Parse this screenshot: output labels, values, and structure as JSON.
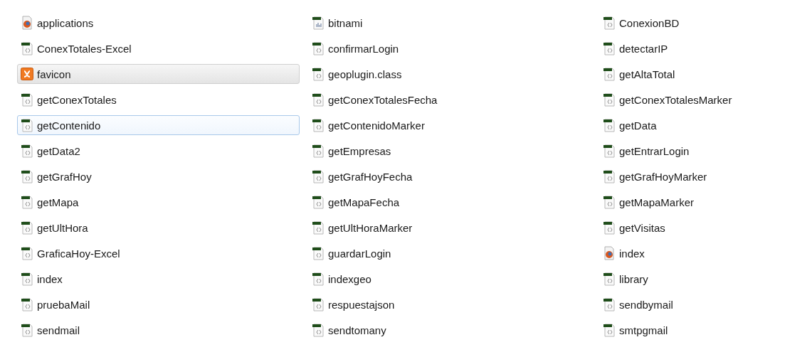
{
  "files": [
    {
      "name": "applications",
      "kind": "html",
      "selected": false,
      "focused": false
    },
    {
      "name": "ConexTotales-Excel",
      "kind": "php",
      "selected": false,
      "focused": false
    },
    {
      "name": "favicon",
      "kind": "xampp",
      "selected": true,
      "focused": false
    },
    {
      "name": "getConexTotales",
      "kind": "php",
      "selected": false,
      "focused": false
    },
    {
      "name": "getContenido",
      "kind": "php",
      "selected": false,
      "focused": true
    },
    {
      "name": "getData2",
      "kind": "php",
      "selected": false,
      "focused": false
    },
    {
      "name": "getGrafHoy",
      "kind": "php",
      "selected": false,
      "focused": false
    },
    {
      "name": "getMapa",
      "kind": "php",
      "selected": false,
      "focused": false
    },
    {
      "name": "getUltHora",
      "kind": "php",
      "selected": false,
      "focused": false
    },
    {
      "name": "GraficaHoy-Excel",
      "kind": "php",
      "selected": false,
      "focused": false
    },
    {
      "name": "index",
      "kind": "php",
      "selected": false,
      "focused": false
    },
    {
      "name": "pruebaMail",
      "kind": "php",
      "selected": false,
      "focused": false
    },
    {
      "name": "sendmail",
      "kind": "php",
      "selected": false,
      "focused": false
    },
    {
      "name": "bitnami",
      "kind": "bitnami",
      "selected": false,
      "focused": false
    },
    {
      "name": "confirmarLogin",
      "kind": "php",
      "selected": false,
      "focused": false
    },
    {
      "name": "geoplugin.class",
      "kind": "php",
      "selected": false,
      "focused": false
    },
    {
      "name": "getConexTotalesFecha",
      "kind": "php",
      "selected": false,
      "focused": false
    },
    {
      "name": "getContenidoMarker",
      "kind": "php",
      "selected": false,
      "focused": false
    },
    {
      "name": "getEmpresas",
      "kind": "php",
      "selected": false,
      "focused": false
    },
    {
      "name": "getGrafHoyFecha",
      "kind": "php",
      "selected": false,
      "focused": false
    },
    {
      "name": "getMapaFecha",
      "kind": "php",
      "selected": false,
      "focused": false
    },
    {
      "name": "getUltHoraMarker",
      "kind": "php",
      "selected": false,
      "focused": false
    },
    {
      "name": "guardarLogin",
      "kind": "php",
      "selected": false,
      "focused": false
    },
    {
      "name": "indexgeo",
      "kind": "php",
      "selected": false,
      "focused": false
    },
    {
      "name": "respuestajson",
      "kind": "php",
      "selected": false,
      "focused": false
    },
    {
      "name": "sendtomany",
      "kind": "php",
      "selected": false,
      "focused": false
    },
    {
      "name": "ConexionBD",
      "kind": "php",
      "selected": false,
      "focused": false
    },
    {
      "name": "detectarIP",
      "kind": "php",
      "selected": false,
      "focused": false
    },
    {
      "name": "getAltaTotal",
      "kind": "php",
      "selected": false,
      "focused": false
    },
    {
      "name": "getConexTotalesMarker",
      "kind": "php",
      "selected": false,
      "focused": false
    },
    {
      "name": "getData",
      "kind": "php",
      "selected": false,
      "focused": false
    },
    {
      "name": "getEntrarLogin",
      "kind": "php",
      "selected": false,
      "focused": false
    },
    {
      "name": "getGrafHoyMarker",
      "kind": "php",
      "selected": false,
      "focused": false
    },
    {
      "name": "getMapaMarker",
      "kind": "php",
      "selected": false,
      "focused": false
    },
    {
      "name": "getVisitas",
      "kind": "php",
      "selected": false,
      "focused": false
    },
    {
      "name": "index",
      "kind": "html",
      "selected": false,
      "focused": false
    },
    {
      "name": "library",
      "kind": "php",
      "selected": false,
      "focused": false
    },
    {
      "name": "sendbymail",
      "kind": "php",
      "selected": false,
      "focused": false
    },
    {
      "name": "smtpgmail",
      "kind": "php",
      "selected": false,
      "focused": false
    }
  ]
}
